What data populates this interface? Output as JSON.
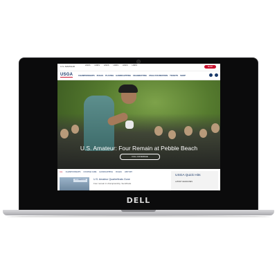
{
  "device": {
    "brand_logo": "DELL"
  },
  "site": {
    "utility_bar": {
      "brand_text": "U.S. AMATEUR",
      "links": [
        "LINKS",
        "LINKS",
        "LINKS",
        "LINKS",
        "LINKS",
        "LINKS"
      ],
      "shop_label": "SHOP"
    },
    "logo": "USGA",
    "nav": {
      "items": [
        "CHAMPIONSHIPS",
        "RULES",
        "PLAYING",
        "HANDICAPPING",
        "CELEBRATING",
        "USGA FOUNDATION",
        "TICKETS",
        "SHOP"
      ]
    },
    "hero": {
      "headline": "U.S. Amateur: Four Remain at Pebble Beach",
      "button_label": "FULL COVERAGE"
    },
    "content_tabs": [
      "ALL",
      "CHAMPIONSHIPS",
      "COURSE CARE",
      "HANDICAPPING",
      "RULES",
      "HISTORY"
    ],
    "story": {
      "title": "U.S. Amateur Quarterfinals Gone",
      "subtitle": "Four remain in championship, Semifinals",
      "thumb_badge": "U.S. AMATEUR"
    },
    "quick_hits": {
      "title": "USGA Quick Hits",
      "item": "LATEST HEADLINES"
    },
    "colors": {
      "primary_navy": "#1b3a6b",
      "accent_red": "#c8102e"
    }
  }
}
